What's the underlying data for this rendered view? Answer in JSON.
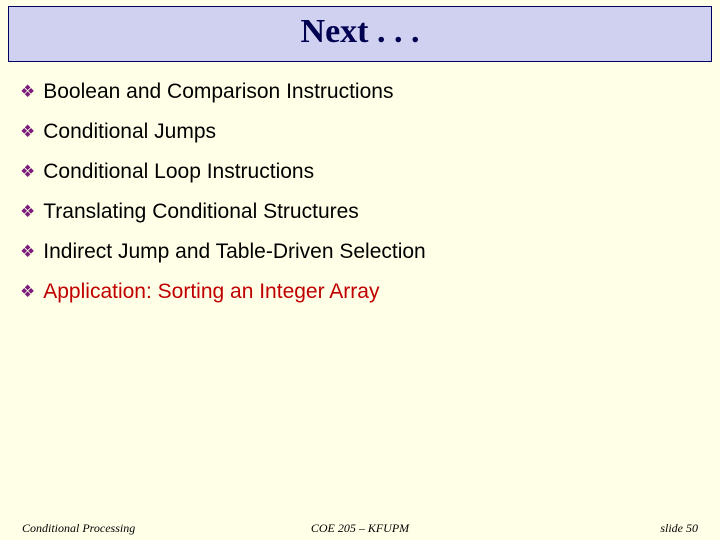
{
  "title": "Next . . .",
  "items": [
    {
      "text": "Boolean and Comparison Instructions",
      "highlight": false
    },
    {
      "text": "Conditional Jumps",
      "highlight": false
    },
    {
      "text": "Conditional Loop Instructions",
      "highlight": false
    },
    {
      "text": "Translating Conditional Structures",
      "highlight": false
    },
    {
      "text": "Indirect Jump and Table-Driven Selection",
      "highlight": false
    },
    {
      "text": "Application: Sorting an Integer Array",
      "highlight": true
    }
  ],
  "footer": {
    "left": "Conditional Processing",
    "center": "COE 205 – KFUPM",
    "right": "slide 50"
  }
}
